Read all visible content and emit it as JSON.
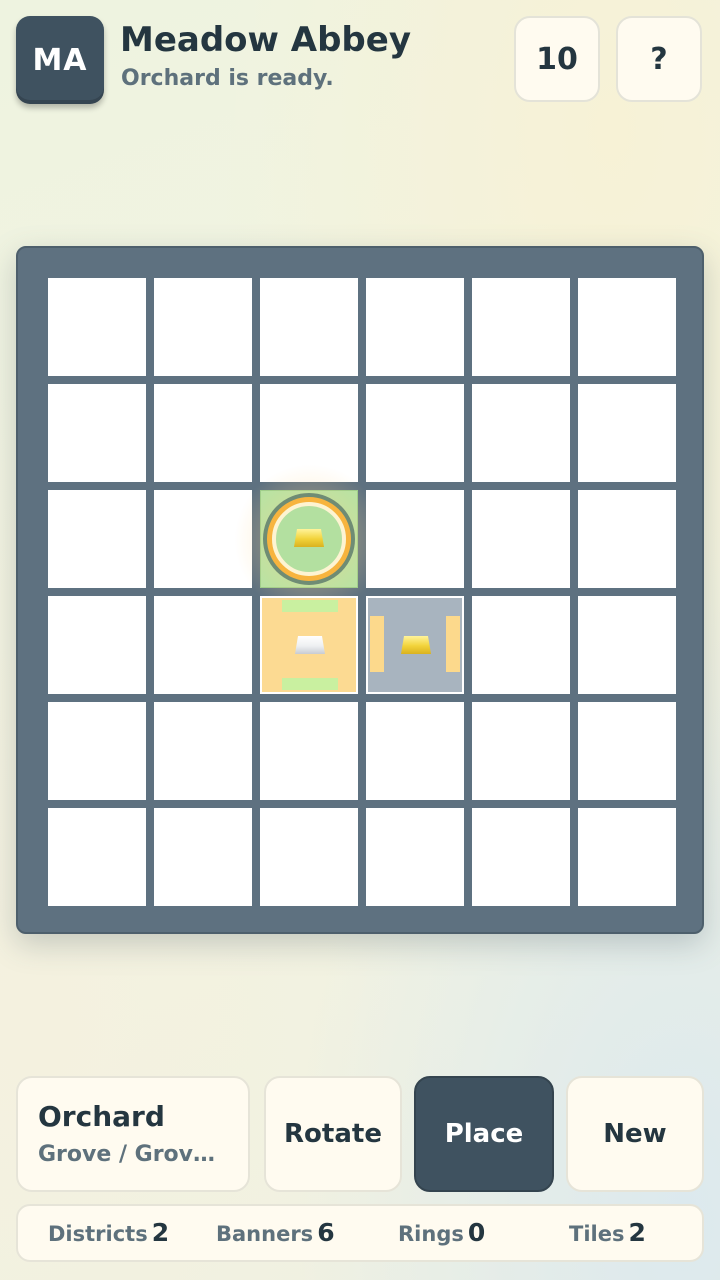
{
  "header": {
    "avatar_initials": "MA",
    "title": "Meadow Abbey",
    "status": "Orchard is ready.",
    "counter": "10",
    "help_label": "?"
  },
  "board": {
    "rows": 6,
    "cols": 6,
    "placed_tiles": [
      {
        "row": 2,
        "col": 2,
        "type": "grove",
        "color": "#b4e3a4",
        "ring": true,
        "gem": "yellow",
        "highlighted": true
      },
      {
        "row": 3,
        "col": 2,
        "type": "orchard",
        "color": "#fcda92",
        "gem": "white"
      },
      {
        "row": 3,
        "col": 3,
        "type": "stone",
        "color": "#a8b4bf",
        "gem": "yellow"
      }
    ]
  },
  "piece": {
    "name": "Orchard",
    "description": "Grove / Grov…"
  },
  "actions": {
    "rotate_label": "Rotate",
    "place_label": "Place",
    "new_label": "New"
  },
  "stats": {
    "districts_label": "Districts",
    "districts_value": "2",
    "banners_label": "Banners",
    "banners_value": "6",
    "rings_label": "Rings",
    "rings_value": "0",
    "tiles_label": "Tiles",
    "tiles_value": "2"
  },
  "colors": {
    "accent_dark": "#3f5260",
    "board": "#5e7180",
    "card": "#fffbf0"
  }
}
